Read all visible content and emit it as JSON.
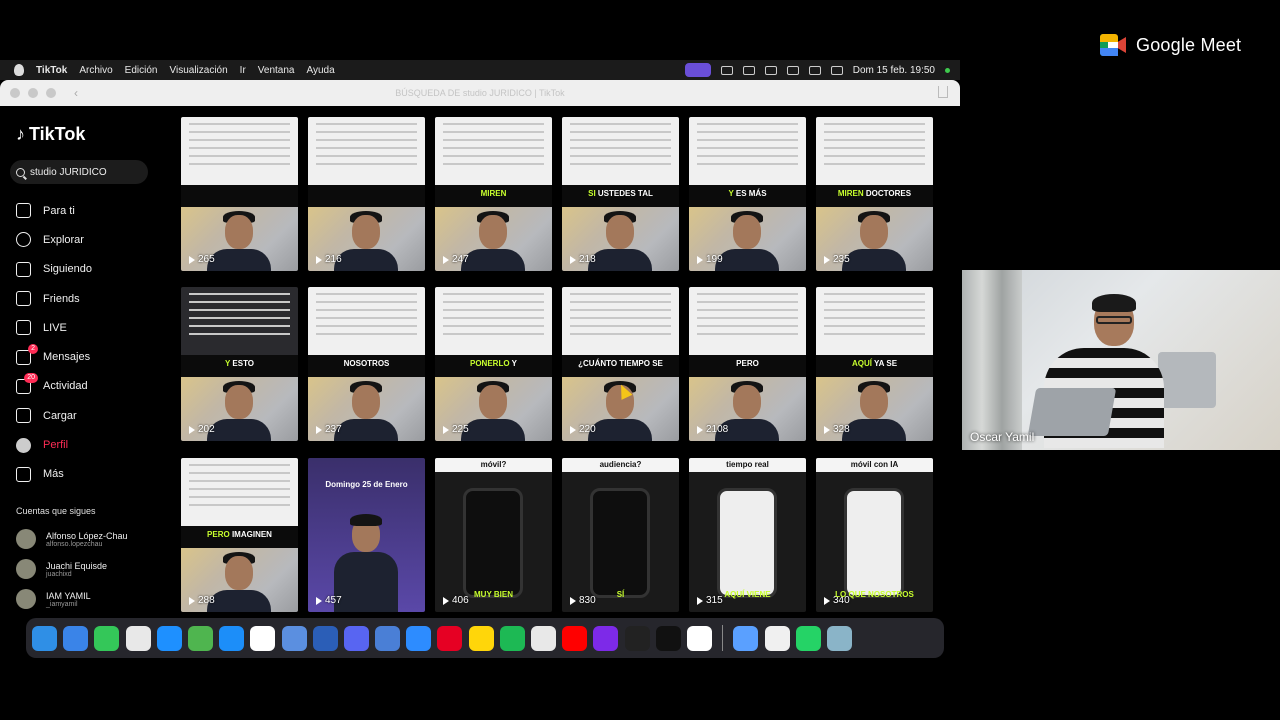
{
  "meet": {
    "brand": "Google Meet",
    "participant_name": "Oscar Yamil"
  },
  "menubar": {
    "app": "TikTok",
    "items": [
      "Archivo",
      "Edición",
      "Visualización",
      "Ir",
      "Ventana",
      "Ayuda"
    ],
    "datetime": "Dom 15 feb. 19:50"
  },
  "window": {
    "title": "BÚSQUEDA DE studio JURIDICO | TikTok"
  },
  "sidebar": {
    "logo": "TikTok",
    "search_value": "studio JURIDICO",
    "nav": [
      {
        "label": "Para ti",
        "icon": "home-icon"
      },
      {
        "label": "Explorar",
        "icon": "compass-icon"
      },
      {
        "label": "Siguiendo",
        "icon": "following-icon"
      },
      {
        "label": "Friends",
        "icon": "friends-icon"
      },
      {
        "label": "LIVE",
        "icon": "live-icon"
      },
      {
        "label": "Mensajes",
        "icon": "messages-icon",
        "badge": "2"
      },
      {
        "label": "Actividad",
        "icon": "activity-icon",
        "badge": "20"
      },
      {
        "label": "Cargar",
        "icon": "upload-icon"
      },
      {
        "label": "Perfil",
        "icon": "profile-icon"
      },
      {
        "label": "Más",
        "icon": "more-icon"
      }
    ],
    "following_title": "Cuentas que sigues",
    "following": [
      {
        "name": "Alfonso López-Chau",
        "user": "alfonso.lopezchau"
      },
      {
        "name": "Juachi Equisde",
        "user": "juachixd"
      },
      {
        "name": "IAM  YAMIL",
        "user": "_iamyamil"
      }
    ]
  },
  "grid": {
    "rows": [
      [
        {
          "caption": "",
          "highlight": "",
          "views": "265"
        },
        {
          "caption": "",
          "highlight": "",
          "views": "216"
        },
        {
          "caption": "",
          "highlight": "MIREN",
          "views": "247"
        },
        {
          "caption": "USTEDES TAL",
          "highlight": "SI",
          "views": "218"
        },
        {
          "caption": "ES MÁS",
          "highlight": "Y",
          "views": "199"
        },
        {
          "caption": "DOCTORES",
          "highlight": "MIREN",
          "views": "235"
        }
      ],
      [
        {
          "caption": "ESTO",
          "highlight": "Y",
          "views": "202"
        },
        {
          "caption": "NOSOTROS",
          "highlight": "",
          "views": "237"
        },
        {
          "caption": "Y",
          "highlight": "PONERLO",
          "views": "225"
        },
        {
          "caption": "¿CUÁNTO TIEMPO SE",
          "highlight": "",
          "views": "220"
        },
        {
          "caption": "PERO",
          "highlight": "",
          "views": "2108"
        },
        {
          "caption": "YA SE",
          "highlight": "AQUÍ",
          "views": "328"
        }
      ],
      [
        {
          "caption": "IMAGINEN",
          "highlight": "PERO",
          "views": "288"
        },
        {
          "caption": "Domingo 25 de Enero",
          "highlight": "",
          "views": "457"
        },
        {
          "caption": "móvil?",
          "highlight": "MUY BIEN",
          "views": "406"
        },
        {
          "caption": "audiencia?",
          "highlight": "SÍ",
          "views": "830"
        },
        {
          "caption": "tiempo real",
          "highlight": "AQUÍ VIENE",
          "views": "315"
        },
        {
          "caption": "móvil con IA",
          "highlight": "LO QUE NOSOTROS",
          "views": "340"
        }
      ]
    ]
  },
  "dock": {
    "apps": [
      "finder",
      "mail",
      "messages",
      "launchpad",
      "safari",
      "maps",
      "app-store",
      "utp",
      "xcode",
      "word",
      "discord",
      "files",
      "zoom",
      "pinterest",
      "notes",
      "spotify",
      "chrome",
      "youtube",
      "canva",
      "voice-memo",
      "tiktok",
      "capcut",
      "assistant",
      "reminders",
      "whatsapp"
    ],
    "colors": [
      "#2f8fe6",
      "#3a84e8",
      "#34c759",
      "#e8e8e8",
      "#1e90ff",
      "#4fb54f",
      "#1c8ef9",
      "#fff",
      "#5b8fe0",
      "#2b5eb7",
      "#5865f2",
      "#4a7fd6",
      "#2d8cff",
      "#e60023",
      "#ffd60a",
      "#1db954",
      "#e8e8e8",
      "#ff0000",
      "#7d2ae8",
      "#222",
      "#111",
      "#fff",
      "#5aa0ff",
      "#f0f0f0",
      "#25d366"
    ]
  }
}
